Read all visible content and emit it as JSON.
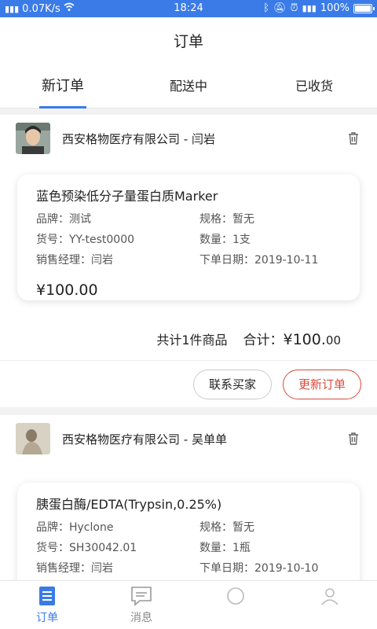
{
  "status_bar": {
    "network": "0.07K/s",
    "time": "18:24",
    "battery": "100%"
  },
  "header": {
    "title": "订单"
  },
  "tabs": [
    {
      "label": "新订单",
      "active": true
    },
    {
      "label": "配送中",
      "active": false
    },
    {
      "label": "已收货",
      "active": false
    }
  ],
  "orders": [
    {
      "shop": "西安格物医疗有限公司 - 闫岩",
      "product": "蓝色预染低分子量蛋白质Marker",
      "brand": "品牌：测试",
      "spec": "规格：暂无",
      "item_no": "货号：YY-test0000",
      "qty": "数量：1支",
      "manager": "销售经理：闫岩",
      "date": "下单日期：2019-10-11",
      "price": "¥100.00",
      "count_text": "共计1件商品",
      "total_label": "合计：",
      "total_main": "¥100.",
      "total_cents": "00",
      "btn_contact": "联系买家",
      "btn_update": "更新订单"
    },
    {
      "shop": "西安格物医疗有限公司 - 吴单单",
      "product": "胰蛋白酶/EDTA(Trypsin,0.25%)",
      "brand": "品牌：Hyclone",
      "spec": "规格：暂无",
      "item_no": "货号：SH30042.01",
      "qty": "数量：1瓶",
      "manager": "销售经理：闫岩",
      "date": "下单日期：2019-10-10"
    }
  ],
  "tabbar": [
    {
      "label": "订单",
      "icon": "order-doc-icon",
      "active": true
    },
    {
      "label": "消息",
      "icon": "message-icon",
      "active": false
    },
    {
      "label": "",
      "icon": "",
      "active": false
    },
    {
      "label": "",
      "icon": "",
      "active": false
    }
  ],
  "colors": {
    "accent": "#3b7be8",
    "danger": "#d94b3c"
  }
}
